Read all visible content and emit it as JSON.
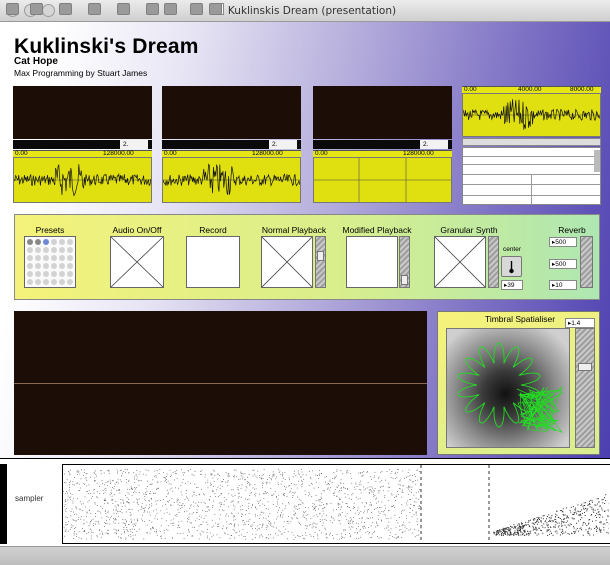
{
  "window": {
    "title": "Kuklinskis Dream (presentation)"
  },
  "header": {
    "title": "Kuklinski's Dream",
    "author": "Cat Hope",
    "credit": "Max Programming by Stuart James"
  },
  "players": [
    {
      "marker": "2.",
      "ruler_start": "0.00",
      "ruler_end": "128000.00"
    },
    {
      "marker": "2.",
      "ruler_start": "0.00",
      "ruler_end": "128000.00"
    },
    {
      "marker": "2.",
      "ruler_start": "0.00",
      "ruler_end": "128000.00"
    }
  ],
  "overview_ruler": [
    "0.00",
    "4000.00",
    "8000.00"
  ],
  "controls": {
    "presets": "Presets",
    "audio": "Audio On/Off",
    "record": "Record",
    "normal": "Normal Playback",
    "modified": "Modified Playback",
    "granular": "Granular Synth",
    "reverb": "Reverb",
    "dial_label": "center",
    "dial_value": "39",
    "reverb_a": "500",
    "reverb_b": "500",
    "reverb_c": "10"
  },
  "spatialiser": {
    "title": "Timbral Spatialiser",
    "value": "1.4"
  },
  "sampler": {
    "label": "sampler"
  },
  "colors": {
    "accent_gradient_end": "#4c3fb0",
    "waveform_bg": "#e0e010",
    "display_bg": "#1c0d06",
    "flower_stroke": "#22dd22"
  },
  "toolbar": {
    "icons": [
      "lock-icon",
      "add-icon",
      "move-icon",
      "save-icon",
      "info-icon",
      "patcher-icon",
      "presentation-icon",
      "grid-icon",
      "snap-icon"
    ]
  }
}
